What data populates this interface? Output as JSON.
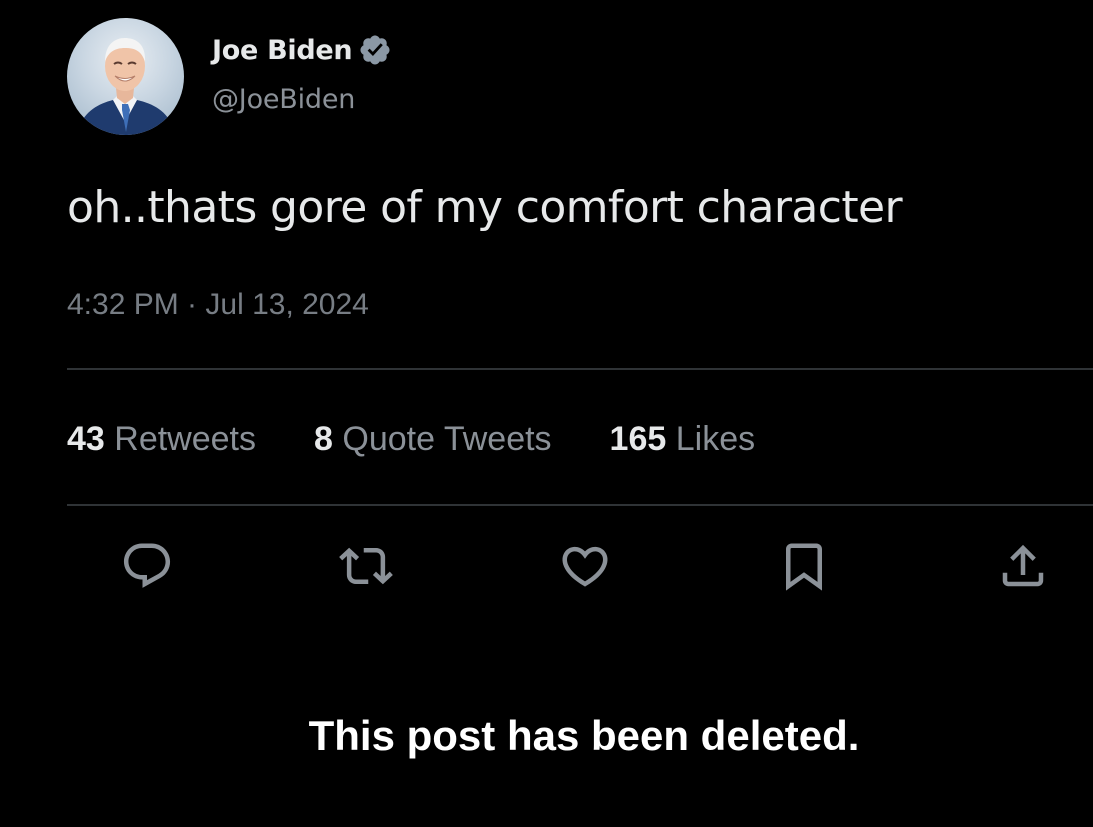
{
  "author": {
    "display_name": "Joe Biden",
    "handle": "@JoeBiden",
    "verified": true,
    "verified_icon": "verified-badge-icon",
    "verified_color": "#8b98a5"
  },
  "tweet": {
    "text": "oh..thats gore of my comfort character",
    "timestamp": "4:32 PM · Jul 13, 2024"
  },
  "stats": [
    {
      "count": "43",
      "label": " Retweets"
    },
    {
      "count": "8",
      "label": " Quote Tweets"
    },
    {
      "count": "165",
      "label": " Likes"
    }
  ],
  "actions": [
    {
      "name": "reply",
      "icon": "reply-icon"
    },
    {
      "name": "retweet",
      "icon": "retweet-icon"
    },
    {
      "name": "like",
      "icon": "heart-icon"
    },
    {
      "name": "bookmark",
      "icon": "bookmark-icon"
    },
    {
      "name": "share",
      "icon": "share-icon"
    }
  ],
  "notice": {
    "text": "This post has been deleted."
  },
  "colors": {
    "background": "#000000",
    "primary_text": "#e7e9ea",
    "secondary_text": "#8b9198",
    "divider": "#2f3336",
    "icon": "#8b9198"
  }
}
